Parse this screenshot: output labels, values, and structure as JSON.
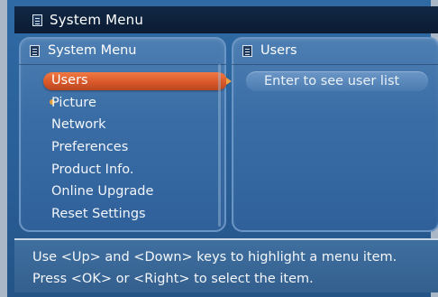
{
  "window": {
    "title": "System Menu"
  },
  "left_panel": {
    "title": "System Menu",
    "items": [
      {
        "label": "Users",
        "selected": true
      },
      {
        "label": "Picture"
      },
      {
        "label": "Network"
      },
      {
        "label": "Preferences"
      },
      {
        "label": "Product Info."
      },
      {
        "label": "Online Upgrade"
      },
      {
        "label": "Reset Settings"
      }
    ]
  },
  "right_panel": {
    "title": "Users",
    "entry": "Enter to see user list"
  },
  "help": {
    "line1": "Use <Up> and <Down> keys to highlight a menu item.",
    "line2": "Press <OK> or <Right> to select the item."
  },
  "colors": {
    "selection": "#d9582a",
    "panel": "#3a6da5",
    "titlebar": "#0b1c33"
  }
}
